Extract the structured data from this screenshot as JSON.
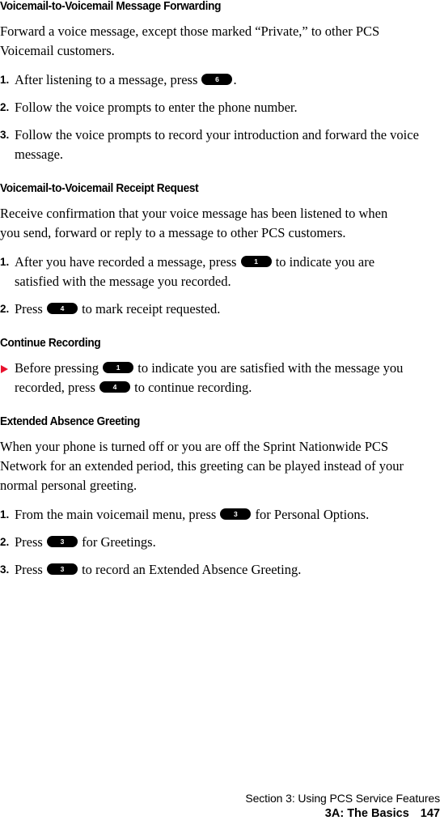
{
  "document": {
    "type": "user-guide-page",
    "sections": [
      {
        "id": "voicemail-to-voicemail-message-forwarding",
        "heading": "Voicemail-to-Voicemail Message Forwarding",
        "intro": "Forward a voice message, except those marked “Private,” to other PCS Voicemail customers.",
        "steps": [
          {
            "num": "1.",
            "marker": "number",
            "before": "After listening to a message, press",
            "key": "6",
            "after": "."
          },
          {
            "num": "2.",
            "marker": "number",
            "before": "Follow the voice prompts to enter the phone number.",
            "key": "",
            "after": ""
          },
          {
            "num": "3.",
            "marker": "number",
            "before": "Follow the voice prompts to record your introduction and forward the voice message.",
            "key": "",
            "after": ""
          }
        ]
      },
      {
        "id": "voicemail-to-voicemail-receipt-request",
        "heading": "Voicemail-to-Voicemail Receipt Request",
        "intro": "Receive confirmation that your voice message has been listened to when you send, forward or reply to a message to other PCS customers.",
        "steps": [
          {
            "num": "1.",
            "marker": "number",
            "before": "After you have recorded a message, press",
            "key": "1",
            "after": "to indicate you are satisfied with the message you recorded."
          },
          {
            "num": "2.",
            "marker": "number",
            "before": "Press",
            "key": "4",
            "after": "to mark receipt requested."
          }
        ]
      },
      {
        "id": "continue-recording",
        "heading": "Continue Recording",
        "intro": "",
        "steps": [
          {
            "num": "",
            "marker": "arrow",
            "before": "Before pressing",
            "key": "1",
            "middle": "to indicate you are satisfied with the message you recorded, press",
            "key2": "4",
            "after": "to continue recording."
          }
        ]
      },
      {
        "id": "extended-absence-greeting",
        "heading": "Extended Absence Greeting",
        "intro": "When your phone is turned off or you are off the Sprint Nationwide PCS Network for an extended period, this greeting can be played instead of your normal personal greeting.",
        "steps": [
          {
            "num": "1.",
            "marker": "number",
            "before": "From the main voicemail menu, press",
            "key": "3",
            "after": "for Personal Options."
          },
          {
            "num": "2.",
            "marker": "number",
            "before": "Press",
            "key": "3",
            "after": "for Greetings."
          },
          {
            "num": "3.",
            "marker": "number",
            "before": "Press",
            "key": "3",
            "after": "to record an Extended Absence Greeting."
          }
        ]
      }
    ]
  },
  "footer": {
    "section_line": "Section 3: Using PCS Service Features",
    "chapter_line": "3A: The Basics",
    "page_number": "147"
  },
  "colors": {
    "text": "#000000",
    "background": "#ffffff",
    "bullet_arrow": "#e8112d",
    "key_background": "#000000",
    "key_text": "#ffffff"
  }
}
